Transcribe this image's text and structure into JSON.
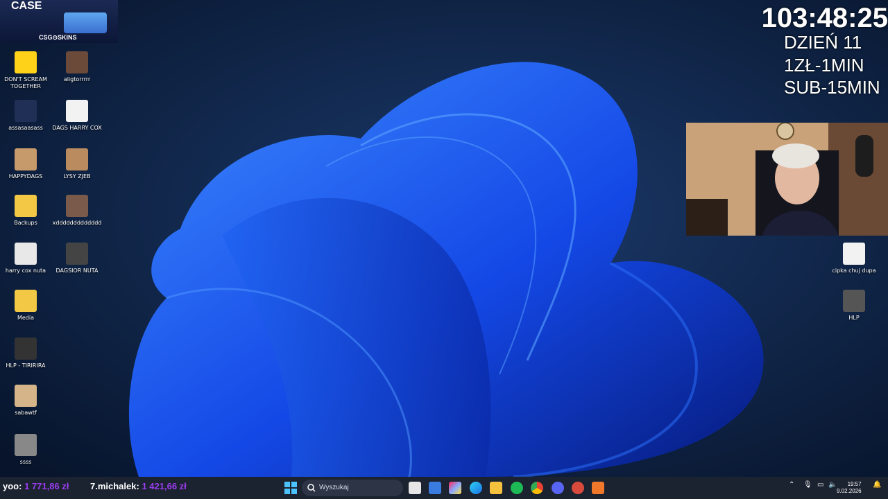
{
  "banner": {
    "title": "CASE",
    "brand": "CSG⊙SKINS"
  },
  "overlay": {
    "timer": "103:48:25",
    "day": "DZIEŃ 11",
    "rate_1": "1ZŁ-1MIN",
    "rate_2": "SUB-15MIN"
  },
  "desktop_icons_left": [
    {
      "label": "DON'T SCREAM TOGETHER",
      "icon": "game-icon",
      "color": "#ffd21a"
    },
    {
      "label": "aligtorrrrr",
      "icon": "image-thumbnail",
      "color": "#6b4a3a"
    },
    {
      "label": "assasaasass",
      "icon": "video-thumbnail",
      "color": "#1f2f55"
    },
    {
      "label": "DAGS HARRY COX",
      "icon": "media-file-icon",
      "color": "#f2f2f2"
    },
    {
      "label": "HAPPYDAGS",
      "icon": "image-thumbnail",
      "color": "#c69a6a"
    },
    {
      "label": "LYSY ZJEB",
      "icon": "image-thumbnail",
      "color": "#b98b5e"
    },
    {
      "label": "Backups",
      "icon": "folder-icon",
      "color": "#f3c845"
    },
    {
      "label": "xddddddddddddd",
      "icon": "image-thumbnail",
      "color": "#7a5a4a"
    },
    {
      "label": "harry cox nuta",
      "icon": "app-icon",
      "color": "#e8e8e8"
    },
    {
      "label": "DAGSIOR NUTA",
      "icon": "video-thumbnail",
      "color": "#444"
    },
    {
      "label": "Media",
      "icon": "folder-icon",
      "color": "#f3c845"
    },
    {
      "label": "HLP - TIRIRIRA",
      "icon": "video-thumbnail",
      "color": "#333"
    },
    {
      "label": "sabawtf",
      "icon": "image-thumbnail",
      "color": "#d6b48a"
    },
    {
      "label": "ssss",
      "icon": "image-thumbnail",
      "color": "#888"
    }
  ],
  "desktop_icons_right": [
    {
      "label": "cipka chuj dupa",
      "icon": "media-file-icon",
      "color": "#f2f2f2"
    },
    {
      "label": "HLP",
      "icon": "video-thumbnail",
      "color": "#555"
    }
  ],
  "ticker": {
    "user_1": "yoo:",
    "amount_1": "1 771,86 zł",
    "user_2": "7.michalek:",
    "amount_2": "1 421,66 zł"
  },
  "taskbar": {
    "search_placeholder": "Wyszukaj",
    "time": "19:57",
    "date": "9.02.2026"
  }
}
